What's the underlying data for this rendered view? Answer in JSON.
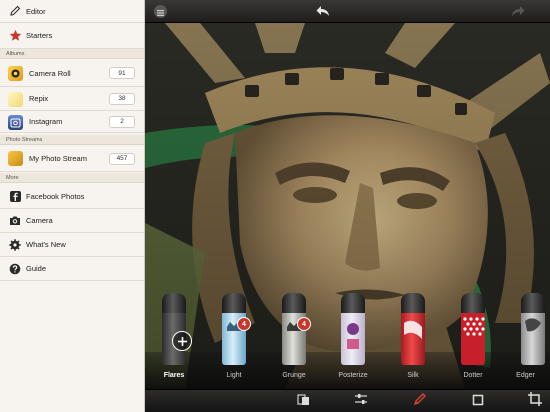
{
  "sidebar": {
    "editor_label": "Editor",
    "starters_label": "Starters",
    "albums_section": "Albums",
    "albums": [
      {
        "label": "Camera Roll",
        "count": "91"
      },
      {
        "label": "Repix",
        "count": "38"
      },
      {
        "label": "Instagram",
        "count": "2"
      }
    ],
    "streams_section": "Photo Streams",
    "streams": [
      {
        "label": "My Photo Stream",
        "count": "457"
      }
    ],
    "more_section": "More",
    "more": [
      {
        "label": "Facebook Photos",
        "icon": "facebook-icon"
      },
      {
        "label": "Camera",
        "icon": "camera-icon"
      },
      {
        "label": "What's New",
        "icon": "gear-icon"
      },
      {
        "label": "Guide",
        "icon": "help-icon"
      }
    ]
  },
  "filters": [
    {
      "label": "Flares",
      "badge": "",
      "selected": true
    },
    {
      "label": "Light",
      "badge": "4",
      "selected": false
    },
    {
      "label": "Grunge",
      "badge": "4",
      "selected": false
    },
    {
      "label": "Posterize",
      "badge": "",
      "selected": false
    },
    {
      "label": "Silk",
      "badge": "",
      "selected": false
    },
    {
      "label": "Dotter",
      "badge": "",
      "selected": false
    },
    {
      "label": "Edger",
      "badge": "",
      "selected": false
    }
  ],
  "colors": {
    "accent_red": "#c9362c",
    "sidebar_bg": "#f7f3ee",
    "toolbar_bg": "#1f1e1d"
  },
  "toolbar_icons": [
    "compare-icon",
    "adjust-sliders-icon",
    "brush-icon",
    "frame-icon",
    "crop-icon"
  ]
}
